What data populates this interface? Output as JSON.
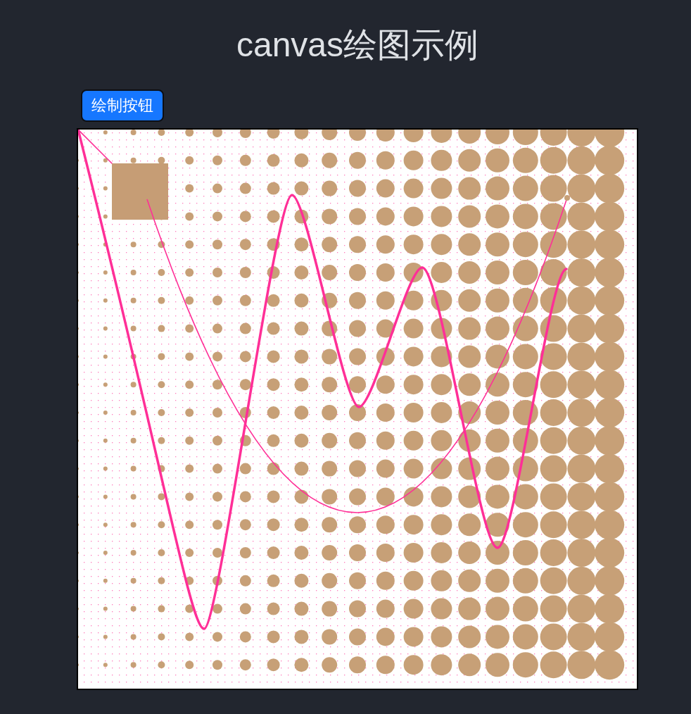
{
  "title": "canvas绘图示例",
  "button": {
    "label": "绘制按钮"
  }
}
